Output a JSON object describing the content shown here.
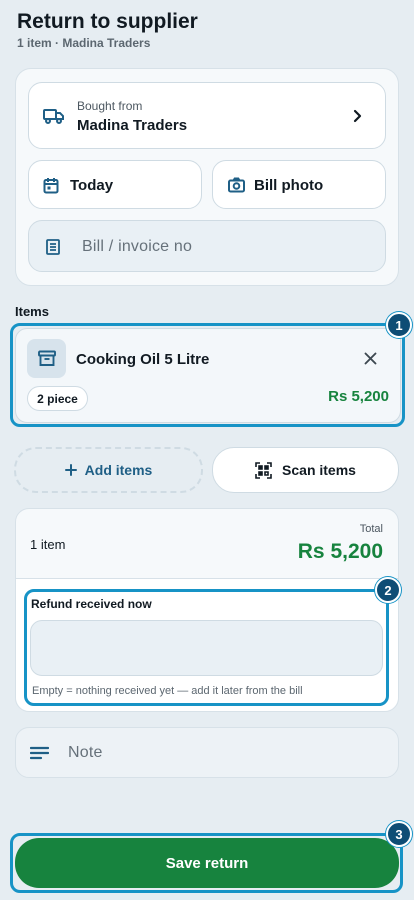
{
  "header": {
    "title": "Return to supplier",
    "subtitle": "1 item · Madina Traders"
  },
  "supplier": {
    "label": "Bought from",
    "name": "Madina Traders",
    "icon": "truck-icon"
  },
  "date_button": {
    "label": "Today",
    "icon": "calendar-icon"
  },
  "photo_button": {
    "label": "Bill photo",
    "icon": "camera-icon"
  },
  "invoice_field": {
    "placeholder": "Bill / invoice no",
    "icon": "receipt-icon"
  },
  "items_section": {
    "label": "Items",
    "items": [
      {
        "name": "Cooking Oil 5 Litre",
        "quantity": "2 piece",
        "price": "Rs 5,200",
        "icon": "archive-box-icon"
      }
    ]
  },
  "actions": {
    "add_label": "Add items",
    "scan_label": "Scan items"
  },
  "summary": {
    "count": "1 item",
    "total_label": "Total",
    "total_value": "Rs 5,200"
  },
  "refund": {
    "label": "Refund received now",
    "value": "",
    "hint": "Empty = nothing received yet — add it later from the bill"
  },
  "note": {
    "placeholder": "Note",
    "icon": "notes-icon"
  },
  "save_label": "Save return",
  "markers": [
    "1",
    "2",
    "3"
  ],
  "colors": {
    "accent_blue": "#1f5f86",
    "highlight": "#1793c6",
    "green": "#17833e",
    "background": "#e6edf2"
  }
}
